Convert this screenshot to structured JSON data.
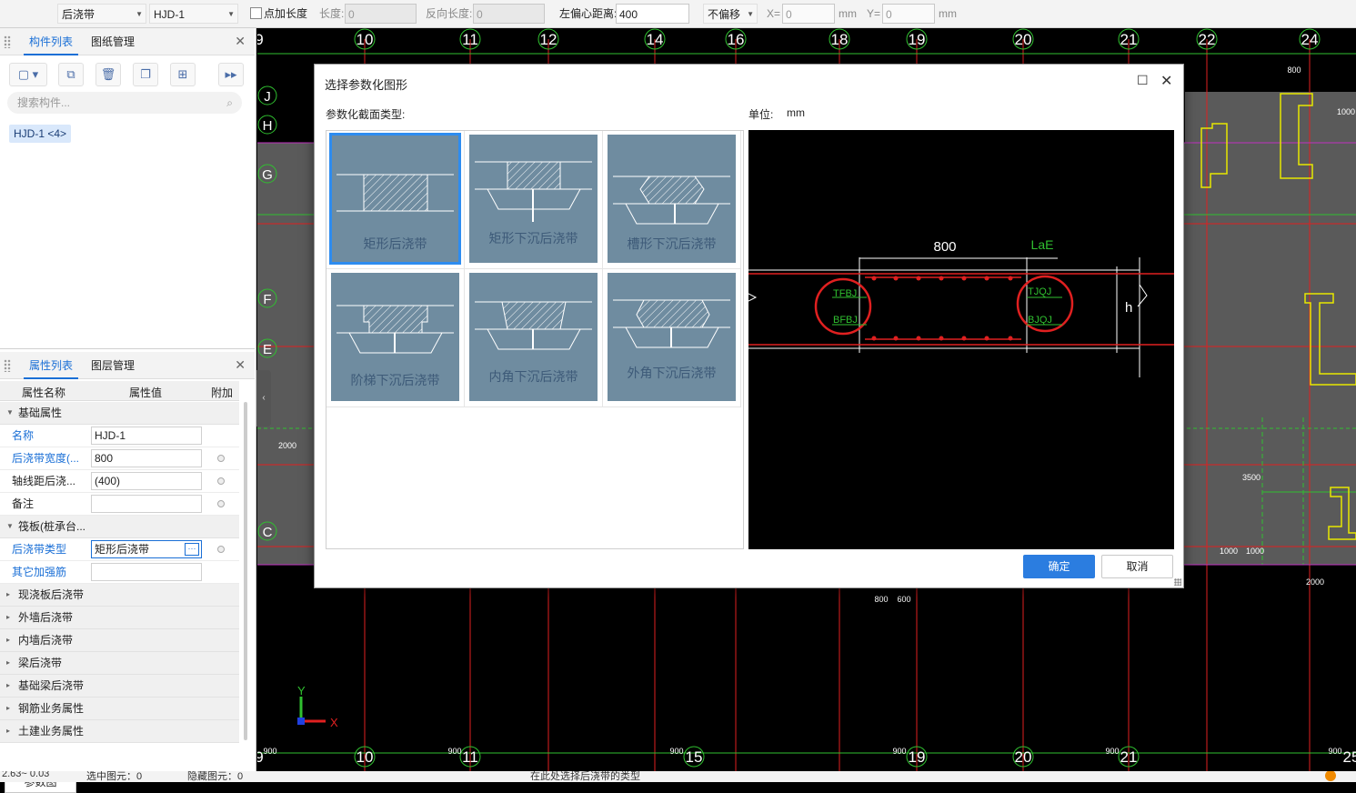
{
  "toolbar": {
    "type_select": "后浇带",
    "name_select": "HJD-1",
    "add_length_label": "点加长度",
    "length_label": "长度:",
    "length_value": "0",
    "reverse_length_label": "反向长度:",
    "reverse_length_value": "0",
    "offset_label": "左偏心距离:",
    "offset_value": "400",
    "offset_mode": "不偏移",
    "x_label": "X=",
    "x_value": "0",
    "y_label": "Y=",
    "y_value": "0",
    "unit": "mm"
  },
  "component_panel": {
    "tabs": [
      "构件列表",
      "图纸管理"
    ],
    "search_placeholder": "搜索构件...",
    "items": [
      "HJD-1 <4>"
    ]
  },
  "property_panel": {
    "tabs": [
      "属性列表",
      "图层管理"
    ],
    "columns": [
      "属性名称",
      "属性值",
      "附加"
    ],
    "group_basic": "基础属性",
    "rows_basic": [
      {
        "name": "名称",
        "value": "HJD-1"
      },
      {
        "name": "后浇带宽度(...",
        "value": "800"
      },
      {
        "name": "轴线距后浇...",
        "value": "(400)"
      },
      {
        "name": "备注",
        "value": ""
      }
    ],
    "group_raft": "筏板(桩承台...",
    "rows_raft": [
      {
        "name": "后浇带类型",
        "value": "矩形后浇带"
      },
      {
        "name": "其它加强筋",
        "value": ""
      }
    ],
    "groups_collapsed": [
      "现浇板后浇带",
      "外墙后浇带",
      "内墙后浇带",
      "梁后浇带",
      "基础梁后浇带",
      "钢筋业务属性",
      "土建业务属性"
    ],
    "param_button": "参数图"
  },
  "dialog": {
    "title": "选择参数化图形",
    "section_label": "参数化截面类型:",
    "unit_label": "单位:",
    "unit_value": "mm",
    "shapes": [
      "矩形后浇带",
      "矩形下沉后浇带",
      "槽形下沉后浇带",
      "阶梯下沉后浇带",
      "内角下沉后浇带",
      "外角下沉后浇带"
    ],
    "preview": {
      "dim_width": "800",
      "dim_lae": "LaE",
      "tags_left": [
        "TFBJ",
        "BFBJ"
      ],
      "tags_right": [
        "TJQJ",
        "BJQJ"
      ],
      "dim_h": "h"
    },
    "ok_label": "确定",
    "cancel_label": "取消"
  },
  "cad": {
    "axis_top": [
      "9",
      "10",
      "11",
      "12",
      "14",
      "16",
      "18",
      "19",
      "20",
      "21",
      "22",
      "24"
    ],
    "axis_bottom": [
      "9",
      "10",
      "11",
      "15",
      "19",
      "20",
      "21",
      "25"
    ],
    "axis_left": [
      "J",
      "H",
      "G",
      "F",
      "E",
      "C"
    ],
    "dims": [
      "800",
      "1000",
      "2000",
      "3500",
      "1000",
      "1000",
      "2000",
      "800",
      "600",
      "900",
      "900",
      "900",
      "900",
      "900",
      "900"
    ]
  },
  "statusbar": {
    "coord": "2.63~ 0.03",
    "selected": "选中图元：0",
    "hidden": "隐藏图元：0",
    "hint": "在此处选择后浇带的类型"
  },
  "colors": {
    "accent": "#1a6fd6",
    "cad_bg": "#000000",
    "gray_fill": "#5a5a5a",
    "red": "#ff2020",
    "green": "#3ad23a",
    "yellow": "#e8e800"
  }
}
